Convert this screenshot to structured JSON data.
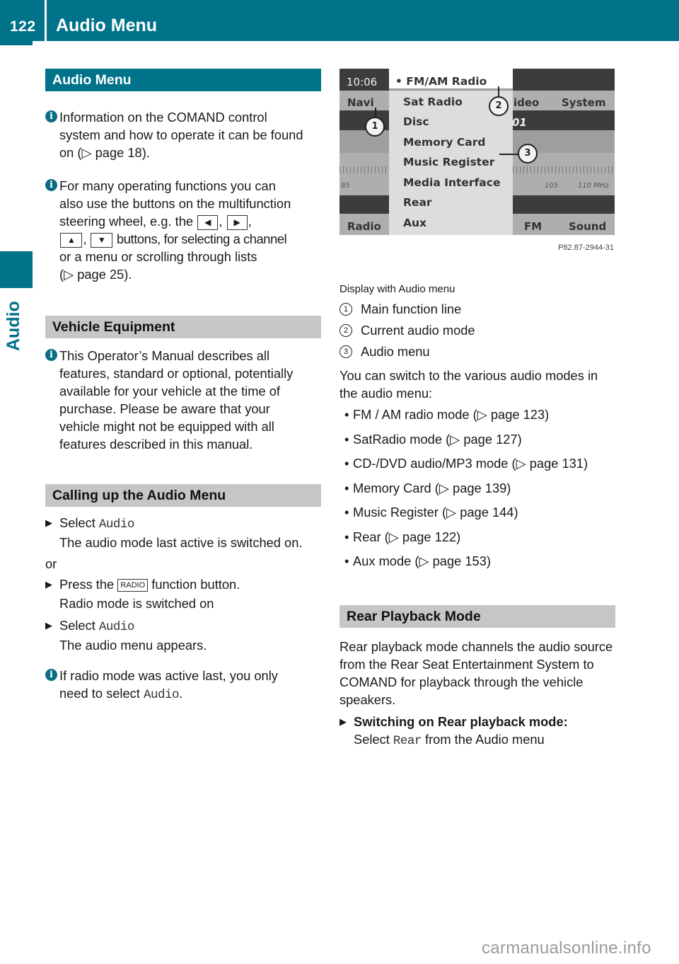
{
  "header": {
    "page_number": "122",
    "title": "Audio Menu"
  },
  "side_tab": {
    "label": "Audio"
  },
  "left": {
    "sec1": {
      "heading": "Audio Menu",
      "info1": {
        "l1": "Information on the COMAND control",
        "l2": "system and how to operate it can be found",
        "l3": "on (▷ page 18)."
      },
      "info2": {
        "l1": "For many operating functions you can",
        "l2": "also use the buttons on the multifunction",
        "l3a": "steering wheel, e.g. the",
        "key_left": "◀",
        "key_right": "▶",
        "key_up": "▲",
        "key_down": "▼",
        "l4b": "buttons, for selecting a channel",
        "l5": "or a menu or scrolling through lists",
        "l6": "(▷ page 25)."
      }
    },
    "sec2": {
      "heading": "Vehicle Equipment",
      "info": {
        "l1": "This Operator’s Manual describes all",
        "l2": "features, standard or optional, potentially",
        "l3": "available for your vehicle at the time of",
        "l4": "purchase. Please be aware that your",
        "l5": "vehicle might not be equipped with all",
        "l6": "features described in this manual."
      }
    },
    "sec3": {
      "heading": "Calling up the Audio Menu",
      "step1": {
        "prefix": "Select",
        "code": "Audio",
        "result": "The audio mode last active is switched on."
      },
      "or": "or",
      "step2": {
        "prefix": "Press the",
        "key": "RADIO",
        "suffix": "function button.",
        "result": "Radio mode is switched on"
      },
      "step3": {
        "prefix": "Select",
        "code": "Audio",
        "result": "The audio menu appears."
      },
      "info": {
        "l1": "If radio mode was active last, you only",
        "l2_prefix": "need to select",
        "code": "Audio",
        "l2_suffix": "."
      }
    }
  },
  "screen": {
    "time": "10:06",
    "top_nav": [
      "Navi",
      "ideo",
      "System"
    ],
    "station_fragment": "01",
    "freq_labels": [
      "85",
      "105",
      "110 MHz"
    ],
    "bottom_nav": [
      "Radio",
      "FM",
      "Sound"
    ],
    "menu_items": [
      "• FM/AM Radio",
      "Sat Radio",
      "Disc",
      "Memory Card",
      "Music Register",
      "Media Interface",
      "Rear",
      "Aux"
    ],
    "callouts": [
      "1",
      "2",
      "3"
    ],
    "figure_code": "P82.87-2944-31"
  },
  "right": {
    "caption": "Display with Audio menu",
    "legend": [
      {
        "num": "1",
        "text": "Main function line"
      },
      {
        "num": "2",
        "text": "Current audio mode"
      },
      {
        "num": "3",
        "text": "Audio menu"
      }
    ],
    "intro": "You can switch to the various audio modes in the audio menu:",
    "modes": [
      "FM / AM radio mode (▷ page 123)",
      "SatRadio mode (▷ page 127)",
      "CD-/DVD audio/MP3 mode (▷ page 131)",
      "Memory Card (▷ page 139)",
      "Music Register (▷ page 144)",
      "Rear (▷ page 122)",
      "Aux mode (▷ page 153)"
    ],
    "rear": {
      "heading": "Rear Playback Mode",
      "para": "Rear playback mode channels the audio source from the Rear Seat Entertainment System to COMAND for playback through the vehicle speakers.",
      "step_title": "Switching on Rear playback mode:",
      "step_prefix": "Select",
      "step_code": "Rear",
      "step_suffix": "from the Audio menu"
    }
  },
  "watermark": "carmanualsonline.info"
}
